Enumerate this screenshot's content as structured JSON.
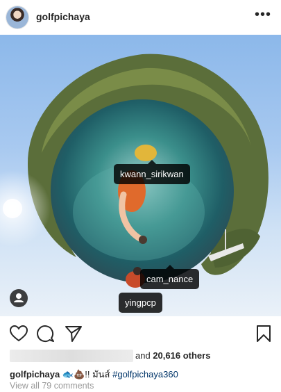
{
  "post": {
    "username": "golfpichaya",
    "more_icon": "more-horizontal-icon"
  },
  "photo": {
    "tags": [
      "kwann_sirikwan",
      "cam_nance",
      "yingpcp"
    ],
    "user_tags_icon": "person-icon"
  },
  "actions": {
    "like_icon": "heart-icon",
    "comment_icon": "comment-icon",
    "share_icon": "paper-plane-icon",
    "save_icon": "bookmark-icon"
  },
  "likes": {
    "and_text": "and",
    "count": "20,616 others"
  },
  "caption": {
    "username": "golfpichaya",
    "text": "🐟💩!! มันส์",
    "hashtag": "#golfpichaya360"
  },
  "comments": {
    "view_all": "View all 79 comments"
  }
}
